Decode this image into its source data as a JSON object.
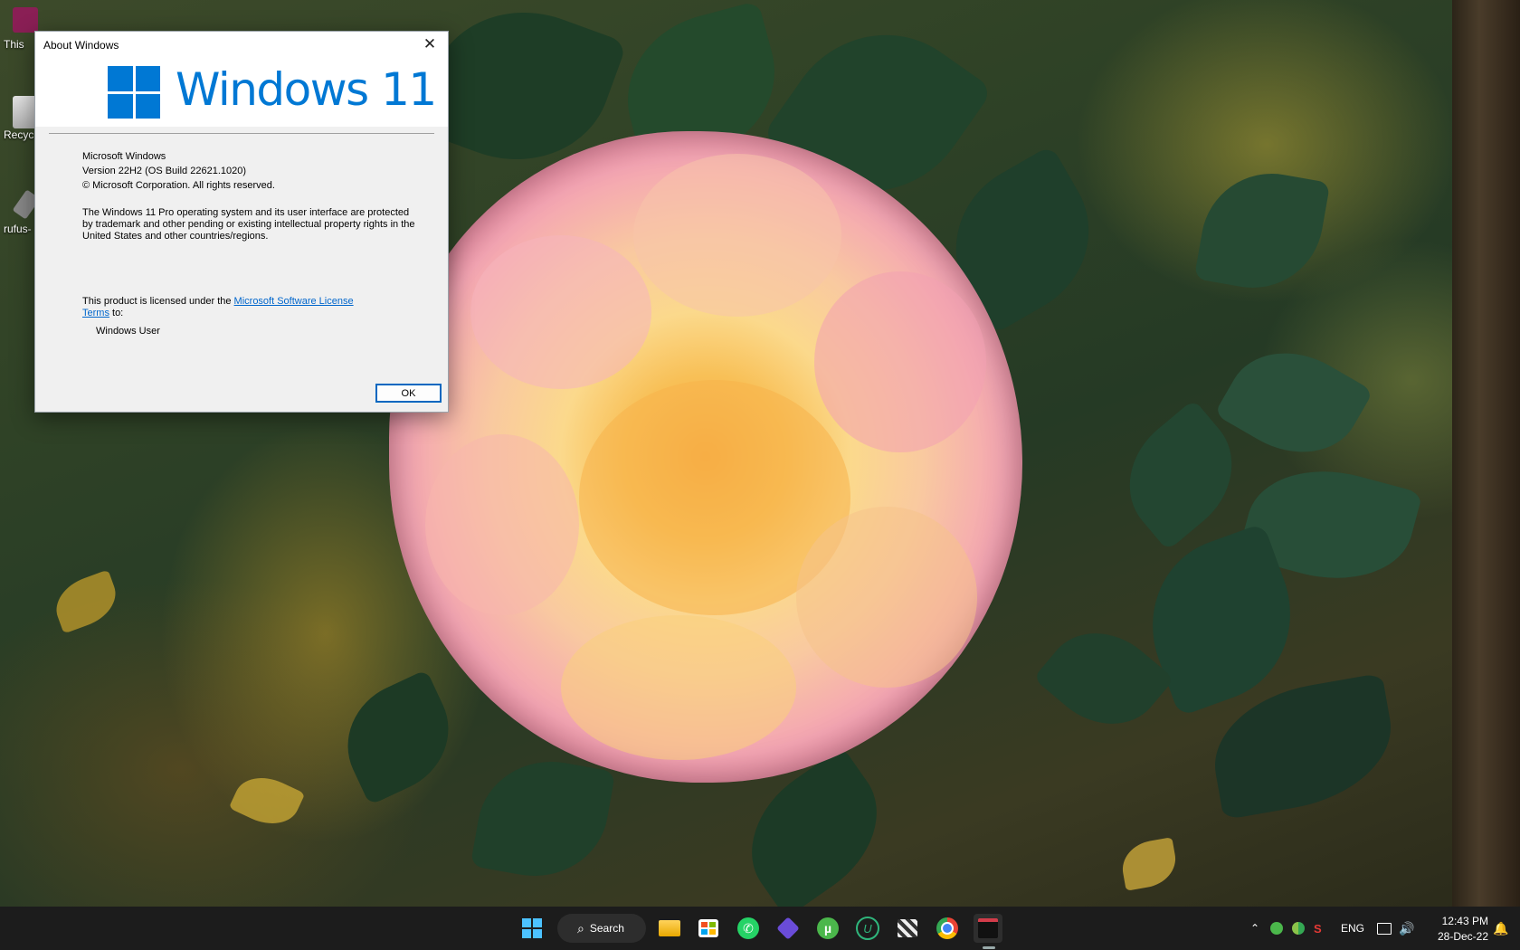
{
  "desktop": {
    "icons": [
      {
        "label": "This",
        "color": "#c2247a"
      },
      {
        "label": "Recyc",
        "color": "#d6d6d6"
      },
      {
        "label": "rufus-",
        "color": "#9a9a9a"
      }
    ]
  },
  "dialog": {
    "title": "About Windows",
    "logo_text": "Windows 11",
    "product": "Microsoft Windows",
    "version": "Version 22H2 (OS Build 22621.1020)",
    "copyright": "© Microsoft Corporation. All rights reserved.",
    "legal": "The Windows 11 Pro operating system and its user interface are protected by trademark and other pending or existing intellectual property rights in the United States and other countries/regions.",
    "license_prefix": "This product is licensed under the ",
    "license_link": "Microsoft Software License Terms",
    "license_suffix": " to:",
    "licensed_user": "Windows User",
    "ok_label": "OK",
    "accent": "#0078d4"
  },
  "taskbar": {
    "search_label": "Search",
    "apps": [
      "start-icon",
      "search",
      "file-explorer-icon",
      "microsoft-store-icon",
      "whatsapp-icon",
      "cube-app-icon",
      "utorrent-icon",
      "u-app-icon",
      "clapper-app-icon",
      "chrome-icon",
      "terminal-icon"
    ],
    "tray_language": "ENG",
    "clock_time": "12:43 PM",
    "clock_date": "28-Dec-22"
  }
}
